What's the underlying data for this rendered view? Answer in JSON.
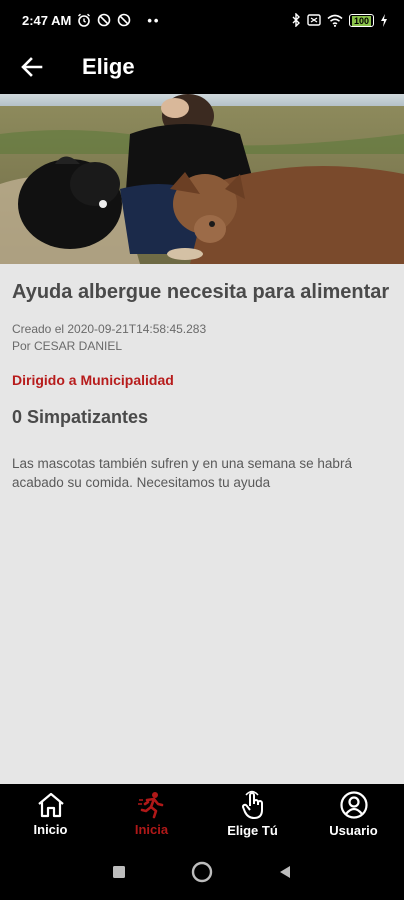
{
  "status_bar": {
    "time": "2:47 AM",
    "battery": "100"
  },
  "app_bar": {
    "title": "Elige",
    "back_icon": "arrow-left-icon"
  },
  "post": {
    "title": "Ayuda albergue necesita para alimentar",
    "created": "Creado el 2020-09-21T14:58:45.283",
    "author": "Por CESAR DANIEL",
    "directed_to": "Dirigido a Municipalidad",
    "supporters": "0 Simpatizantes",
    "description": "Las mascotas también sufren y en una semana se habrá acabado su comida. Necesitamos tu ayuda"
  },
  "bottom_nav": {
    "items": [
      {
        "label": "Inicio",
        "icon": "home-icon"
      },
      {
        "label": "Inicia",
        "icon": "runner-icon"
      },
      {
        "label": "Elige Tú",
        "icon": "hand-pointer-icon"
      },
      {
        "label": "Usuario",
        "icon": "user-circle-icon"
      }
    ],
    "active_index": 1
  },
  "colors": {
    "accent": "#b01818",
    "content_bg": "#e6e6e6",
    "bar_bg": "#000000"
  }
}
